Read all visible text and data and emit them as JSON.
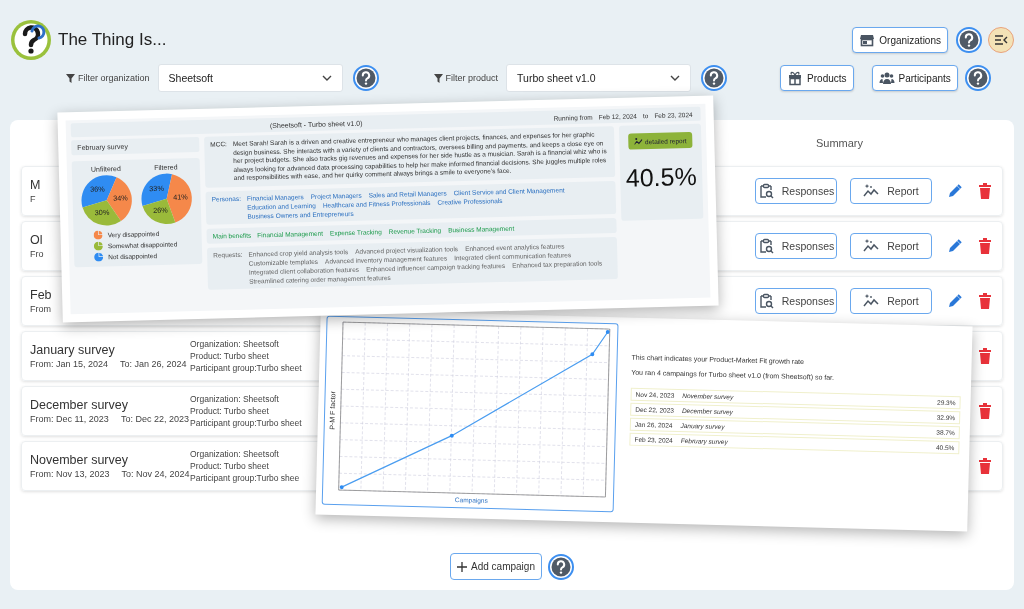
{
  "app": {
    "title": "The Thing Is..."
  },
  "header_buttons": [
    {
      "label": "Organizations"
    }
  ],
  "filters": [
    {
      "label": "Filter organization",
      "value": "Sheetsoft"
    },
    {
      "label": "Filter product",
      "value": "Turbo sheet v1.0"
    }
  ],
  "nav_buttons": [
    {
      "label": "Products",
      "kind": "gift"
    },
    {
      "label": "Participants",
      "kind": "people"
    }
  ],
  "campaigns": {
    "column": "Summary",
    "rows": [
      {
        "title": "M",
        "from": "F",
        "actions": [
          {
            "kind": "responses",
            "label": "Responses"
          },
          {
            "kind": "report",
            "label": "Report"
          },
          {
            "kind": "edit"
          },
          {
            "kind": "delete"
          }
        ]
      },
      {
        "title": "Ol",
        "from": "Fro",
        "actions": [
          {
            "kind": "responses",
            "label": "Responses"
          },
          {
            "kind": "report",
            "label": "Report"
          },
          {
            "kind": "edit"
          },
          {
            "kind": "delete"
          }
        ]
      },
      {
        "title": "Feb",
        "from": "From",
        "actions": [
          {
            "kind": "responses",
            "label": "Responses"
          },
          {
            "kind": "report",
            "label": "Report"
          },
          {
            "kind": "edit"
          },
          {
            "kind": "delete"
          }
        ]
      },
      {
        "title": "January survey",
        "from": "From: Jan 15, 2024",
        "to": "To: Jan 26, 2024",
        "details": [
          "Organization: Sheetsoft",
          "Product: Turbo sheet",
          "Participant group:Turbo sheet"
        ],
        "actions": [
          {
            "kind": "delete"
          }
        ]
      },
      {
        "title": "December survey",
        "from": "From: Dec 11, 2023",
        "to": "To: Dec 22, 2023",
        "details": [
          "Organization: Sheetsoft",
          "Product: Turbo sheet",
          "Participant group:Turbo sheet"
        ],
        "actions": [
          {
            "kind": "delete"
          }
        ]
      },
      {
        "title": "November survey",
        "from": "From: Nov 13, 2023",
        "to": "To: Nov 24, 2024",
        "details": [
          "Organization: Sheetsoft",
          "Product: Turbo sheet",
          "Participant group:Turbo shee"
        ],
        "actions": [
          {
            "kind": "delete"
          }
        ]
      }
    ],
    "add_button": "Add campaign"
  },
  "report_card": {
    "heading": "(Sheetsoft - Turbo sheet v1.0)",
    "running_label": "Running from",
    "start": "Feb 12, 2024",
    "to_label": "to",
    "end": "Feb 23, 2024",
    "survey": "February survey",
    "pies": [
      {
        "chart_data": {
          "type": "pie",
          "title": "Unfiltered",
          "categories": [
            "Very disappointed",
            "Somewhat disappointed",
            "Not disappointed"
          ],
          "series": [
            {
              "values": [
                34,
                30,
                36
              ]
            }
          ],
          "value_labels": [
            "34%",
            "30%",
            "36%"
          ]
        }
      },
      {
        "chart_data": {
          "type": "pie",
          "title": "Filtered",
          "series": [
            {
              "values": [
                41,
                26,
                33
              ]
            }
          ],
          "value_labels": [
            "41%",
            "26%",
            "33%"
          ]
        }
      }
    ],
    "legend": [
      {
        "color": "#f5884a"
      },
      {
        "color": "#9aba3a"
      },
      {
        "color": "#2f8cf2"
      }
    ],
    "mcc_label": "MCC:",
    "mcc": "Meet Sarah! Sarah is a driven and creative entrepreneur who manages client projects, finances, and expenses for her graphic design business. She interacts with a variety of clients and contractors, oversees billing and payments, and keeps a close eye on her project budgets. She also tracks gig revenues and expenses for her side hustle as a musician. Sarah is a financial whiz who is always looking for advanced data processing capabilities to help her make informed financial decisions. She juggles multiple roles and responsibilities with ease, and her quirky comment always brings a smile to everyone's face.",
    "groups": [
      {
        "kind": "personas",
        "label": "Personas:",
        "items": [
          "Financial Managers",
          "Project Managers",
          "Sales and Retail Managers",
          "Client Service and Client Management",
          "Education and Learning",
          "Healthcare and Fitness Professionals",
          "Creative Professionals",
          "Business Owners and Entrepreneurs"
        ]
      },
      {
        "kind": "benefits",
        "label": "Main benefits",
        "items": [
          "Financial Management",
          "Expense Tracking",
          "Revenue Tracking",
          "Business Management"
        ]
      },
      {
        "kind": "requests",
        "label": "Requests:",
        "items": [
          "Enhanced crop yield analysis tools",
          "Advanced project visualization tools",
          "Enhanced event analytics features",
          "Customizable templates",
          "Advanced inventory management features",
          "Integrated client communication features",
          "Integrated client collaboration features",
          "Enhanced influencer campaign tracking features",
          "Enhanced tax preparation tools",
          "Streamlined catering order management features"
        ]
      }
    ],
    "report_button": "detailed report",
    "score": "40.5%"
  },
  "growth_card": {
    "ylabel": "P-M F factor",
    "xlabel": "Campaigns",
    "intro": "This chart indicates your Product-Market Fit growth rate",
    "summary": "You ran 4 campaings for Turbo sheet v1.0 (from Sheetsoft) so far.",
    "rows": [
      {
        "date": "Nov 24, 2023",
        "name": "November survey",
        "value": "29.3%"
      },
      {
        "date": "Dec 22, 2023",
        "name": "December survey",
        "value": "32.9%"
      },
      {
        "date": "Jan 26, 2024",
        "name": "January survey",
        "value": "38.7%"
      },
      {
        "date": "Feb 23, 2024",
        "name": "February survey",
        "value": "40.5%"
      }
    ]
  }
}
